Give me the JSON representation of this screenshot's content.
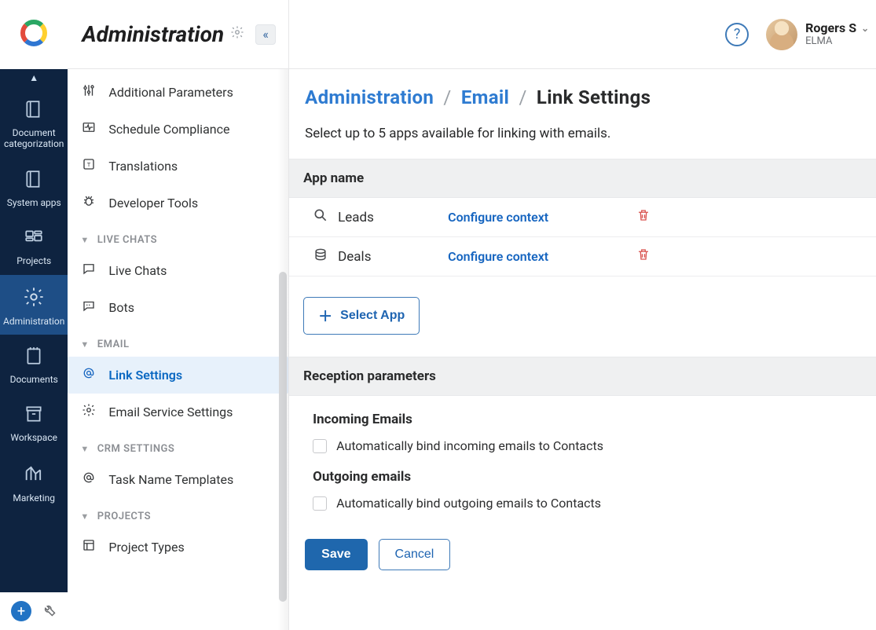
{
  "rail": {
    "items": [
      {
        "label": "Document categorization",
        "icon": "book"
      },
      {
        "label": "System apps",
        "icon": "book"
      },
      {
        "label": "Projects",
        "icon": "board"
      },
      {
        "label": "Administration",
        "icon": "gear"
      },
      {
        "label": "Documents",
        "icon": "note"
      },
      {
        "label": "Workspace",
        "icon": "archive"
      },
      {
        "label": "Marketing",
        "icon": "analytics"
      }
    ],
    "active_index": 3
  },
  "sidebar": {
    "title": "Administration",
    "items": [
      {
        "type": "item",
        "label": "Additional Parameters",
        "icon": "sliders"
      },
      {
        "type": "item",
        "label": "Schedule Compliance",
        "icon": "heartbeat"
      },
      {
        "type": "item",
        "label": "Translations",
        "icon": "translate"
      },
      {
        "type": "item",
        "label": "Developer Tools",
        "icon": "bug"
      },
      {
        "type": "group",
        "label": "LIVE CHATS"
      },
      {
        "type": "item",
        "label": "Live Chats",
        "icon": "chat"
      },
      {
        "type": "item",
        "label": "Bots",
        "icon": "bot"
      },
      {
        "type": "group",
        "label": "EMAIL"
      },
      {
        "type": "item",
        "label": "Link Settings",
        "icon": "at",
        "active": true
      },
      {
        "type": "item",
        "label": "Email Service Settings",
        "icon": "gear"
      },
      {
        "type": "group",
        "label": "CRM SETTINGS"
      },
      {
        "type": "item",
        "label": "Task Name Templates",
        "icon": "at"
      },
      {
        "type": "group",
        "label": "PROJECTS"
      },
      {
        "type": "item",
        "label": "Project Types",
        "icon": "layout"
      }
    ]
  },
  "topbar": {
    "user_name": "Rogers S",
    "company": "ELMA"
  },
  "breadcrumbs": {
    "root": "Administration",
    "section": "Email",
    "page": "Link Settings"
  },
  "page": {
    "lead": "Select up to 5 apps available for linking with emails.",
    "app_table_header": "App name",
    "rows": [
      {
        "name": "Leads",
        "icon": "magnifier",
        "configure": "Configure context"
      },
      {
        "name": "Deals",
        "icon": "coins",
        "configure": "Configure context"
      }
    ],
    "select_app_label": "Select App",
    "reception_header": "Reception parameters",
    "incoming_header": "Incoming Emails",
    "incoming_checkbox": "Automatically bind incoming emails to Contacts",
    "outgoing_header": "Outgoing emails",
    "outgoing_checkbox": "Automatically bind outgoing emails to Contacts",
    "save_label": "Save",
    "cancel_label": "Cancel"
  }
}
